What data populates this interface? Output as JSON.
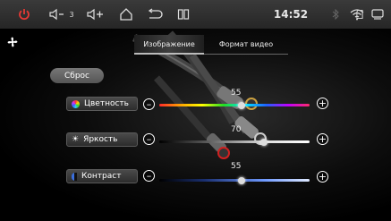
{
  "status_bar": {
    "power_icon": "power-icon",
    "vol_down_label": "3",
    "vol_icon": "volume-icon",
    "time": "14:52",
    "icons": [
      "bluetooth-icon",
      "wifi-icon",
      "sd-card-icon",
      "window-icon"
    ]
  },
  "tabs": [
    {
      "label": "Изображение",
      "active": true
    },
    {
      "label": "Формат видео",
      "active": false
    }
  ],
  "reset_label": "Сброс",
  "rows": [
    {
      "label": "Цветность",
      "value": "55",
      "level": 0.55
    },
    {
      "label": "Яркость",
      "value": "70",
      "level": 0.7
    },
    {
      "label": "Контраст",
      "value": "55",
      "level": 0.55
    }
  ],
  "colors": {
    "accent_power": "#e53935",
    "color_track": "rainbow",
    "brightness_track": "#ffffff",
    "contrast_track": "#3f6fd8"
  }
}
